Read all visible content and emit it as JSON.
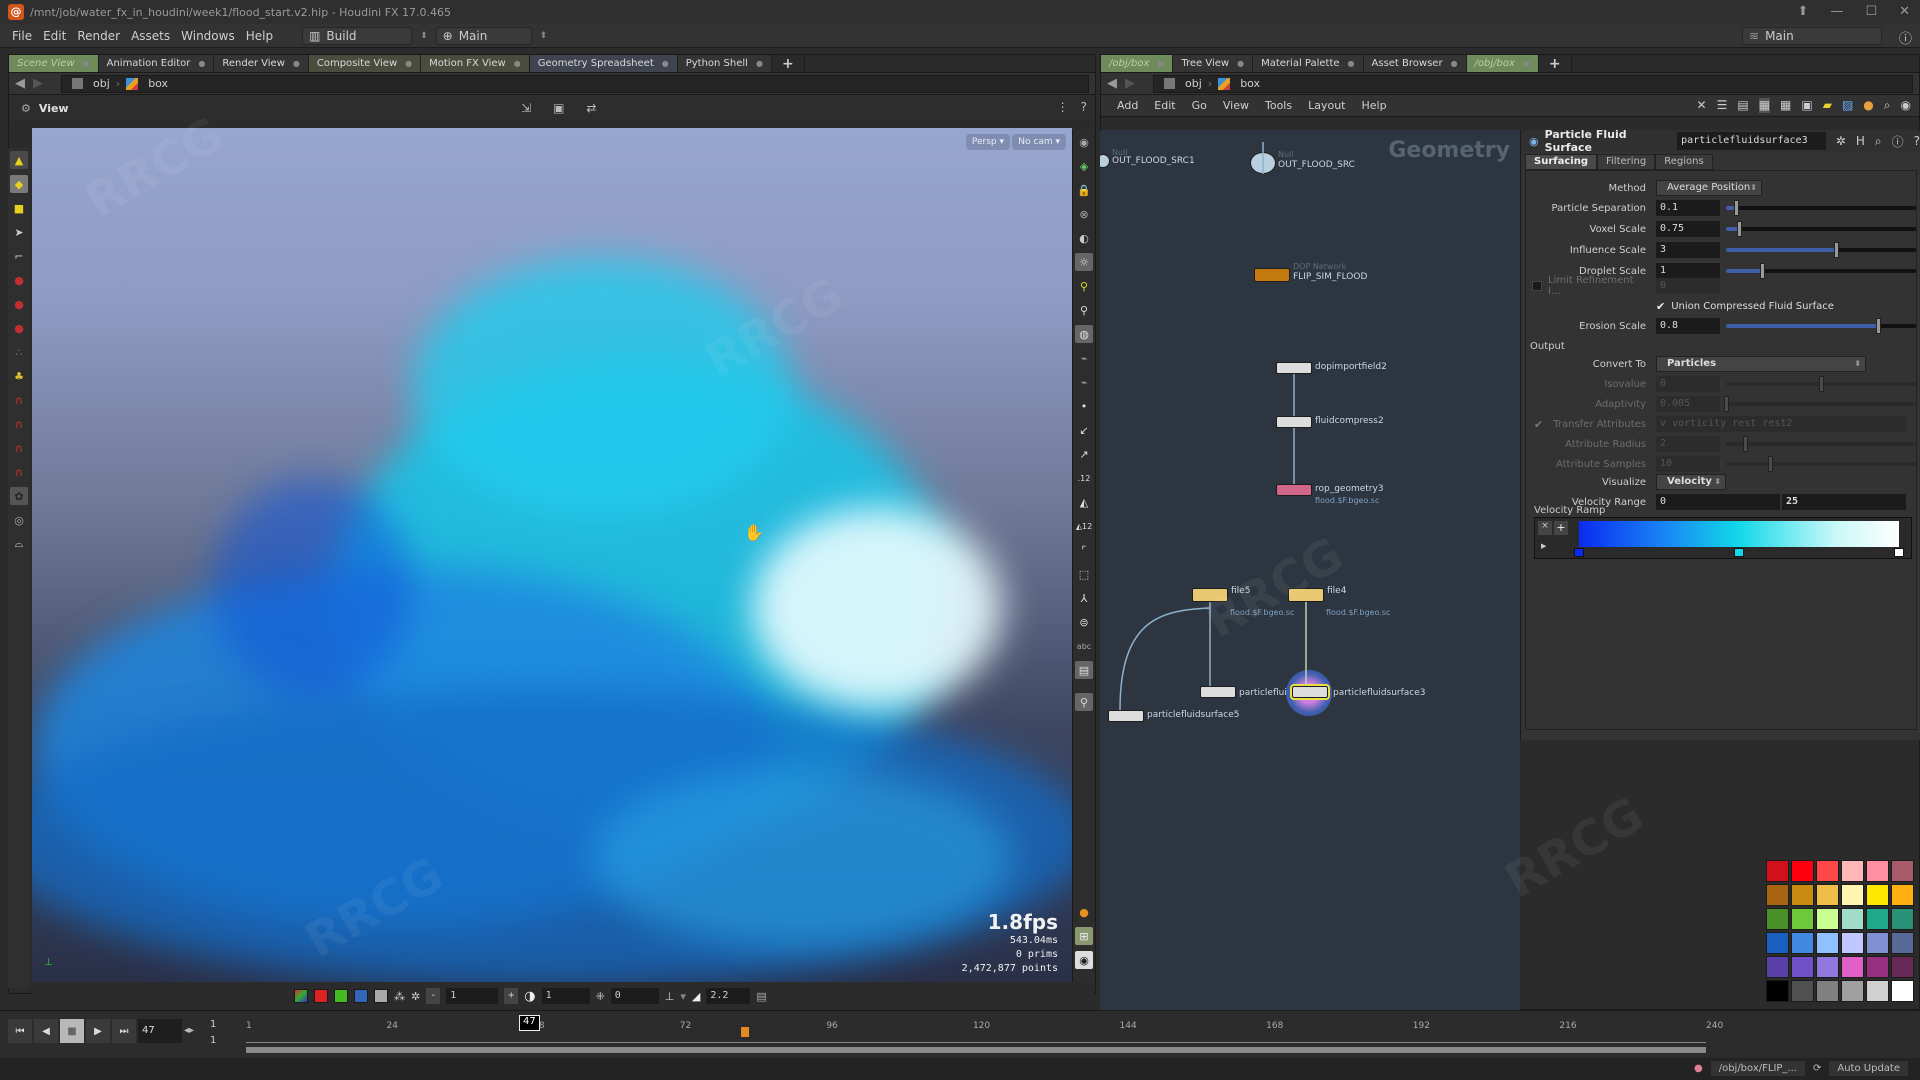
{
  "window": {
    "title": "/mnt/job/water_fx_in_houdini/week1/flood_start.v2.hip - Houdini FX 17.0.465",
    "controls": [
      "up-arrow",
      "minimize",
      "maximize",
      "close"
    ]
  },
  "menubar": {
    "items": [
      "File",
      "Edit",
      "Render",
      "Assets",
      "Windows",
      "Help"
    ],
    "desktop": "Build",
    "runtime": "Main",
    "right_desktop": "Main"
  },
  "left_pane": {
    "tabs": [
      {
        "label": "Scene View",
        "active": true
      },
      {
        "label": "Animation Editor"
      },
      {
        "label": "Render View"
      },
      {
        "label": "Composite View"
      },
      {
        "label": "Motion FX View"
      },
      {
        "label": "Geometry Spreadsheet"
      },
      {
        "label": "Python Shell"
      }
    ],
    "path": [
      "obj",
      "box"
    ],
    "view_label": "View",
    "camera_menu": "Persp",
    "camera_select": "No cam",
    "stats": {
      "fps": "1.8fps",
      "time": "543.04ms",
      "prims": "0  prims",
      "points": "2,472,877 points"
    },
    "bottom_bar": {
      "point_size": "1",
      "opacity": "1",
      "offset": "0",
      "gamma": "2.2"
    }
  },
  "right_pane": {
    "tabs": [
      {
        "label": "/obj/box",
        "active": true
      },
      {
        "label": "Tree View"
      },
      {
        "label": "Material Palette"
      },
      {
        "label": "Asset Browser"
      },
      {
        "label": "/obj/box",
        "active": true
      }
    ],
    "path": [
      "obj",
      "box"
    ],
    "menu": [
      "Add",
      "Edit",
      "Go",
      "View",
      "Tools",
      "Layout",
      "Help"
    ],
    "context_label": "Geometry"
  },
  "network": {
    "nodes": [
      {
        "name": "OUT_FLOOD_SRC1",
        "type": "Null"
      },
      {
        "name": "OUT_FLOOD_SRC",
        "type": "Null"
      },
      {
        "name": "FLIP_SIM_FLOOD",
        "type": "DOP Network"
      },
      {
        "name": "dopimportfield2"
      },
      {
        "name": "fluidcompress2"
      },
      {
        "name": "rop_geometry3",
        "sub": "flood.$F.bgeo.sc"
      },
      {
        "name": "file5",
        "sub": "flood.$F.bgeo.sc"
      },
      {
        "name": "file4",
        "sub": "flood.$F.bgeo.sc"
      },
      {
        "name": "particlefluidsurface5"
      },
      {
        "name": "particlefluidsurf..."
      },
      {
        "name": "particlefluidsurface3",
        "selected": true
      }
    ]
  },
  "parm_editor": {
    "node_type": "Particle Fluid Surface",
    "node_name": "particlefluidsurface3",
    "tabs": [
      "Surfacing",
      "Filtering",
      "Regions"
    ],
    "active_tab": "Surfacing",
    "method_label": "Method",
    "method": "Average Position",
    "params": [
      {
        "label": "Particle Separation",
        "value": "0.1",
        "slider": 0.05
      },
      {
        "label": "Voxel Scale",
        "value": "0.75",
        "slider": 0.07
      },
      {
        "label": "Influence Scale",
        "value": "3",
        "slider": 0.58
      },
      {
        "label": "Droplet Scale",
        "value": "1",
        "slider": 0.19
      }
    ],
    "limit_refinement": {
      "label": "Limit Refinement I...",
      "value": "0",
      "checked": false
    },
    "union_compressed": {
      "label": "Union Compressed Fluid Surface",
      "checked": true
    },
    "erosion": {
      "label": "Erosion Scale",
      "value": "0.8",
      "slider": 0.8
    },
    "output_label": "Output",
    "convert_to_label": "Convert To",
    "convert_to": "Particles",
    "disabled_params": [
      {
        "label": "Isovalue",
        "value": "0",
        "slider": 0.5
      },
      {
        "label": "Adaptivity",
        "value": "0.005",
        "slider": 0.0
      },
      {
        "label": "Transfer Attributes",
        "value": "v vorticity rest rest2"
      },
      {
        "label": "Attribute Radius",
        "value": "2",
        "slider": 0.1
      },
      {
        "label": "Attribute Samples",
        "value": "10",
        "slider": 0.23
      }
    ],
    "visualize_label": "Visualize",
    "visualize": "Velocity",
    "velocity_range_label": "Velocity Range",
    "velocity_range": [
      "0",
      "25"
    ],
    "ramp_label": "Velocity Ramp",
    "ramp_keys": [
      {
        "pos": 0.0,
        "color": "#0a2cf0"
      },
      {
        "pos": 0.5,
        "color": "#12d9e8"
      },
      {
        "pos": 1.0,
        "color": "#ffffff"
      }
    ]
  },
  "palette": {
    "colors": [
      [
        "#d0101a",
        "#ff0010",
        "#ff4848",
        "#ffb7b8",
        "#ff8fa0",
        "#a85a6a"
      ],
      [
        "#a86410",
        "#c88a10",
        "#f0be48",
        "#fff5b0",
        "#ffe800",
        "#ffb010"
      ],
      [
        "#4a9028",
        "#6fc83a",
        "#c8ff90",
        "#a0dcc8",
        "#20a88a",
        "#2a9078"
      ],
      [
        "#1a60c0",
        "#4088e0",
        "#90c0ff",
        "#c0c8ff",
        "#8090d0",
        "#5a6a98"
      ],
      [
        "#5840a8",
        "#7050c8",
        "#9078e0",
        "#e060c8",
        "#983080",
        "#682858"
      ],
      [
        "#000000",
        "#505050",
        "#808080",
        "#a0a0a0",
        "#d0d0d0",
        "#ffffff"
      ]
    ]
  },
  "timeline": {
    "current_frame": "47",
    "start": "1",
    "end": "1",
    "ticks": [
      "1",
      "24",
      "48",
      "72",
      "96",
      "120",
      "144",
      "168",
      "192",
      "216",
      "240"
    ],
    "range_end": 240
  },
  "statusbar": {
    "path": "/obj/box/FLIP_...",
    "update_mode": "Auto Update"
  },
  "watermark": "RRCG"
}
